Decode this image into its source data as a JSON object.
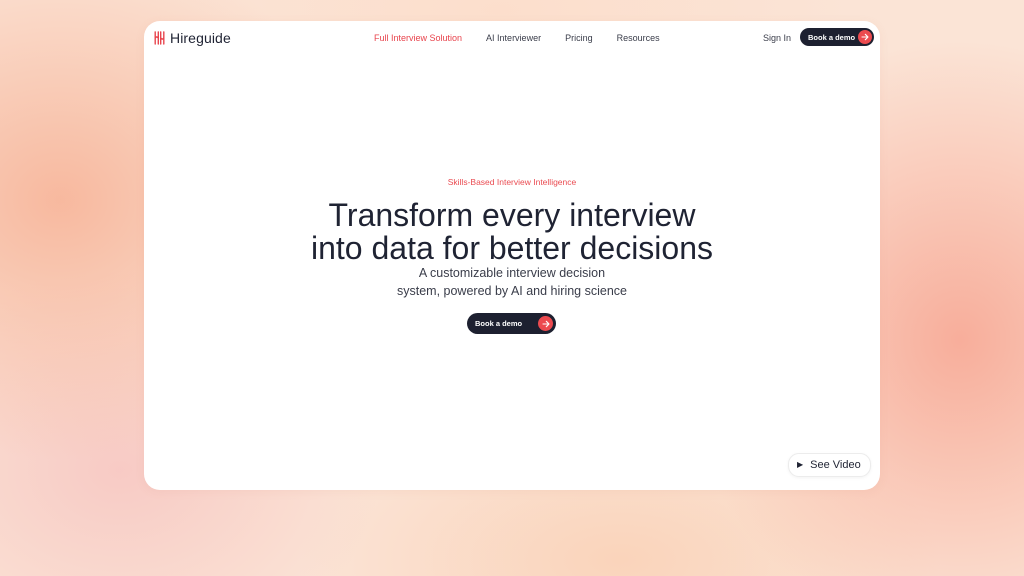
{
  "brand": {
    "name": "Hireguide",
    "color": "#e8444d"
  },
  "nav": {
    "items": [
      {
        "label": "Full Interview Solution",
        "active": true
      },
      {
        "label": "AI Interviewer",
        "active": false
      },
      {
        "label": "Pricing",
        "active": false
      },
      {
        "label": "Resources",
        "active": false
      }
    ],
    "signin_label": "Sign In",
    "cta_label": "Book a demo"
  },
  "hero": {
    "eyebrow": "Skills-Based Interview Intelligence",
    "headline_line1": "Transform every interview",
    "headline_line2": "into data for better decisions",
    "sub_line1": "A customizable interview decision",
    "sub_line2": "system, powered by AI and hiring science",
    "cta_label": "Book a demo"
  },
  "video": {
    "label": "See Video",
    "icon": "play-icon"
  },
  "colors": {
    "accent": "#ec4a4f",
    "dark_button": "#1d2030",
    "text": "#1f2333"
  }
}
